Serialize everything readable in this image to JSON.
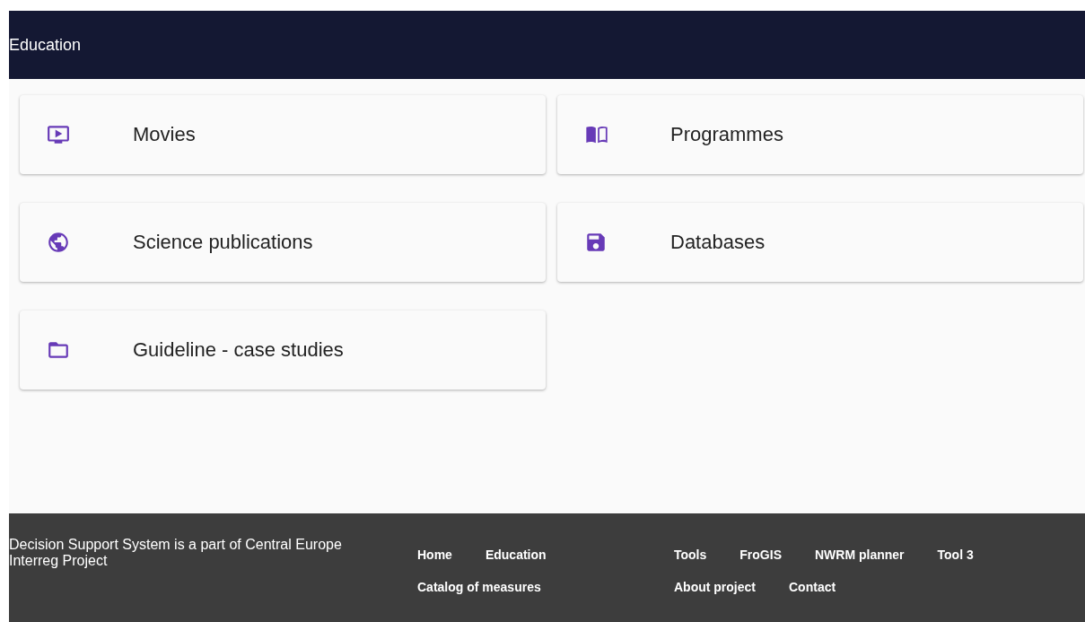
{
  "header": {
    "title": "Education"
  },
  "cards": [
    {
      "kind": "tv",
      "label": "Movies"
    },
    {
      "kind": "book",
      "label": "Programmes"
    },
    {
      "kind": "globe",
      "label": "Science publications"
    },
    {
      "kind": "save",
      "label": "Databases"
    },
    {
      "kind": "folder",
      "label": "Guideline - case studies"
    }
  ],
  "footer": {
    "text": "Decision Support System is a part of Central Europe Interreg Project",
    "link_groups": [
      [
        "Home",
        "Education",
        "Catalog of measures"
      ],
      [
        "Tools",
        "FroGIS",
        "NWRM planner",
        "Tool 3",
        "About project",
        "Contact"
      ]
    ]
  }
}
